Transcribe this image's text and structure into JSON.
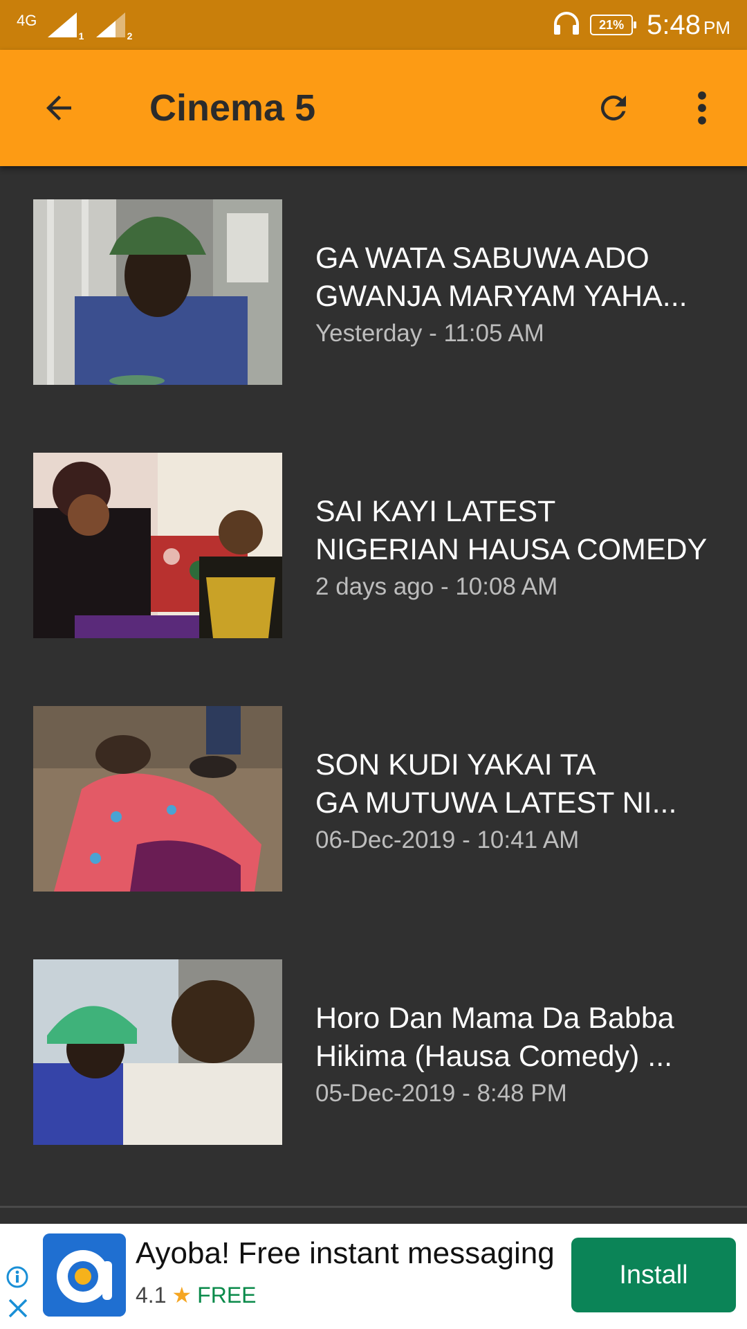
{
  "status_bar": {
    "network": "4G",
    "sim1": "1",
    "sim2": "2",
    "battery": "21%",
    "time": "5:48",
    "ampm": "PM"
  },
  "app_bar": {
    "title": "Cinema 5",
    "icons": [
      "arrow-left-icon",
      "refresh-icon",
      "more-vert-icon"
    ]
  },
  "videos": [
    {
      "title_line1": "GA WATA SABUWA ADO",
      "title_line2": "GWANJA MARYAM YAHA...",
      "time": "Yesterday - 11:05 AM"
    },
    {
      "title_line1": "SAI KAYI LATEST",
      "title_line2": "NIGERIAN HAUSA COMEDY",
      "time": "2 days ago - 10:08 AM"
    },
    {
      "title_line1": "SON KUDI YAKAI TA",
      "title_line2": "GA MUTUWA LATEST NI...",
      "time": "06-Dec-2019 - 10:41 AM"
    },
    {
      "title_line1": "Horo Dan Mama Da Babba",
      "title_line2": "Hikima (Hausa Comedy) ...",
      "time": "05-Dec-2019 - 8:48 PM"
    }
  ],
  "ad": {
    "title": "Ayoba! Free instant messaging",
    "rating": "4.1",
    "price": "FREE",
    "install_label": "Install"
  },
  "colors": {
    "status_bar": "#c97f0b",
    "app_bar": "#fd9b14",
    "background": "#303030",
    "install_button": "#0b8457"
  }
}
